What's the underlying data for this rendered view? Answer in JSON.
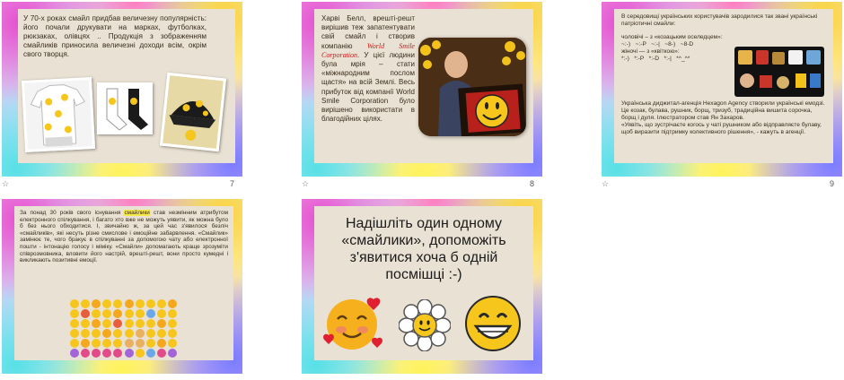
{
  "slides": [
    {
      "number": "7",
      "text": "У 70-х роках смайл придбав величезну популярність: його почали друкувати на марках, футболках, рюкзаках, олівцях .. Продукція з зображенням смайликів приносила величезні доходи всім, окрім свого творця."
    },
    {
      "number": "8",
      "text_a": "Харві Белл, врешті-решт вирішив теж запатентувати свій смайл і створив компанію ",
      "brand": "World Smile Corporation",
      "text_b": ". У цієї людини була мрія – стати «міжнародним послом щастя» на всій Землі. Весь прибуток від компанії World Smile Corporation було вирішено використати в благодійних цілях."
    },
    {
      "number": "9",
      "intro": "В середовищі українських користувачів зародилися так звані українські патріотичні смайли:",
      "line1": "чоловічі – з «козацьким оселедцем»:",
      "line2": "~:-)   ~:-P   ~:-|   ~8-)   ~8-D",
      "line3": "жіночі — з «квіткою»:",
      "line4": "*:-)   *:-P   *:-D   *:-|   *^_^*",
      "para2": "Українська диджитал-агенція Hexagon Agency створили українські емодзі.",
      "para3": "Це козак, булава, рушник, борщ, тризуб, традиційна вишита сорочка, борщ і дуля. Ілюстратором став Ян Захаров.",
      "para4": "«Уявіть, що зустрічаєте когось у чаті рушником або відправляєте булаву, щоб виразити підтримку колективного рішення», - кажуть в агенції."
    },
    {
      "text_a": "За понад 30 років свого існування ",
      "highlight": "смайлики",
      "text_b": " став незмінним атрибутом електронного спілкування, і багато хто вже не можуть уявити, як можна було б без нього обходитися. І, звичайно ж, за цей час з'явилося безліч «смайликів», які несуть різне смислове і емоційне забарвлення. «Смайлик» замінює те, чого бракує в спілкуванні за допомогою чату або електронної пошти - інтонацію голосу і міміку. «Смайли» допомагають краще зрозуміти співрозмовника, вловити його настрій, врешті-решт, вони просто кумедні і викликають позитивні емоції."
    },
    {
      "title": "Надішліть один одному «смайлики», допоможіть з'явитися хоча б одній посмішці :-)"
    }
  ],
  "icons": {
    "star": "☆",
    "smiley": "smiley-icon"
  },
  "colors": {
    "panel": "#e9e1d3",
    "brand_red": "#d01818",
    "highlight": "#f5e84c",
    "smiley_yellow": "#f6c61d"
  }
}
